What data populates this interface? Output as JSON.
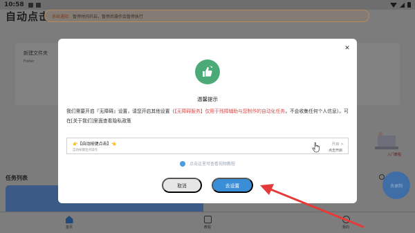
{
  "status_bar": {
    "time": "10:58"
  },
  "app": {
    "title": "自动点击",
    "notice": {
      "tag": "系统通知",
      "text": "暂停时间开启，暂停后操作会暂停执行"
    },
    "folder": {
      "name": "新建文件夹",
      "sub": "Folder"
    },
    "task_list_title": "任务列表",
    "right_deco_label": "入门教程",
    "fab_label": "去录制",
    "nav": [
      {
        "label": "首页",
        "icon": "home-icon"
      },
      {
        "label": "教程",
        "icon": "document-icon"
      },
      {
        "label": "我的",
        "icon": "user-icon"
      }
    ]
  },
  "dialog": {
    "title": "温馨提示",
    "body_part1": "我们需要开启『无障碍』设置，请您开启其他设置（",
    "body_red": "【无障碍服务】仅用于残障辅助与您制作的自动化任务",
    "body_part2": "，不会收集任何个人信息）。可在[关于我们]里面查看隐私政策",
    "sample": {
      "title": "👉【自动按键点击】👈",
      "sub": "自动按键连点操作",
      "open": "开启 >",
      "click_hint": "点击开启"
    },
    "video_link": "点击这里可查看视频教程",
    "cancel_label": "取消",
    "confirm_label": "去设置",
    "close_icon": "close-icon",
    "hero_icon": "thumbs-up-icon",
    "accent": "#3a8ed8",
    "warning_red": "#e04a4a"
  }
}
